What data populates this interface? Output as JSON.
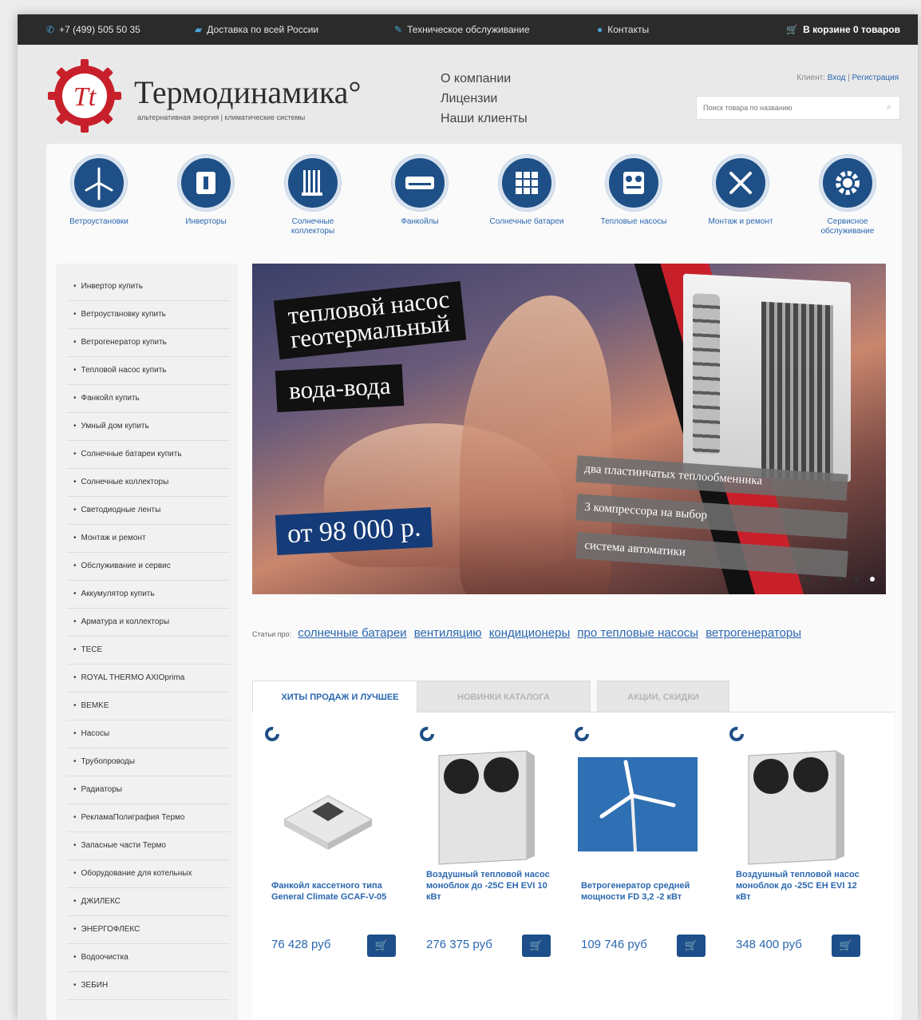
{
  "topbar": {
    "phone": "+7 (499) 505 50 35",
    "delivery": "Доставка по всей России",
    "service": "Техническое обслуживание",
    "contacts": "Контакты",
    "cart": "В корзине 0 товаров"
  },
  "header": {
    "logo_letters": "Tt",
    "title": "Термодинамика°",
    "subtitle": "альтернативная энергия | климатические системы",
    "nav": [
      "О компании",
      "Лицензии",
      "Наши клиенты"
    ],
    "auth_prefix": "Клиент:",
    "login": "Вход",
    "register": "Регистрация",
    "search_placeholder": "Поиск товара по названию",
    "brand_color": "#c8202b"
  },
  "categories": [
    {
      "label": "Ветроустановки",
      "icon": "wind-turbine-icon"
    },
    {
      "label": "Инверторы",
      "icon": "inverter-icon"
    },
    {
      "label": "Солнечные коллекторы",
      "icon": "solar-collector-icon"
    },
    {
      "label": "Фанкойлы",
      "icon": "fancoil-icon"
    },
    {
      "label": "Солнечные батареи",
      "icon": "solar-panel-icon"
    },
    {
      "label": "Тепловые насосы",
      "icon": "heat-pump-icon"
    },
    {
      "label": "Монтаж и ремонт",
      "icon": "tools-icon"
    },
    {
      "label": "Сервисное обслуживание",
      "icon": "service-gear-icon"
    }
  ],
  "sidebar": [
    "Инвертор купить",
    "Ветроустановку купить",
    "Ветрогенератор купить",
    "Тепловой насос купить",
    "Фанкойл купить",
    "Умный дом купить",
    "Солнечные батареи купить",
    "Солнечные коллекторы",
    "Светодиодные ленты",
    "Монтаж и ремонт",
    "Обслуживание и сервис",
    "Аккумулятор купить",
    "Арматура и коллекторы",
    "TECE",
    "ROYAL THERMO AXIOprima",
    "BEMKE",
    "Насосы",
    "Трубопроводы",
    "Радиаторы",
    "РекламаПолиграфия Термо",
    "Запасные части Термо",
    "Оборудование для котельных",
    "ДЖИЛЕКС",
    "ЭНЕРГОФЛЕКС",
    "Водоочистка",
    "ЗЕБИН"
  ],
  "banner": {
    "line1": "тепловой насос",
    "line2": "геотермальный",
    "line3": "вода-вода",
    "price": "от 98 000 р.",
    "features": [
      "два пластинчатых теплообменника",
      "3 компрессора на выбор",
      "система автоматики"
    ]
  },
  "articles": {
    "prefix": "Статьи про:",
    "links": [
      "солнечные батареи",
      "вентиляцию",
      "кондиционеры",
      "про тепловые насосы",
      "ветрогенераторы"
    ]
  },
  "tabs": [
    "ХИТЫ ПРОДАЖ И ЛУЧШЕЕ",
    "НОВИНКИ КАТАЛОГА",
    "АКЦИИ, СКИДКИ"
  ],
  "products": [
    {
      "name": "Фанкойл кассетного типа General Climate GCAF-V-05",
      "price": "76 428 руб"
    },
    {
      "name": "Воздушный тепловой насос моноблок до -25С EH EVI 10 кВт",
      "price": "276 375 руб"
    },
    {
      "name": "Ветрогенератор средней мощности FD 3,2 -2 кВт",
      "price": "109 746 руб"
    },
    {
      "name": "Воздушный тепловой насос моноблок до -25С EH EVI 12 кВт",
      "price": "348 400 руб"
    }
  ]
}
